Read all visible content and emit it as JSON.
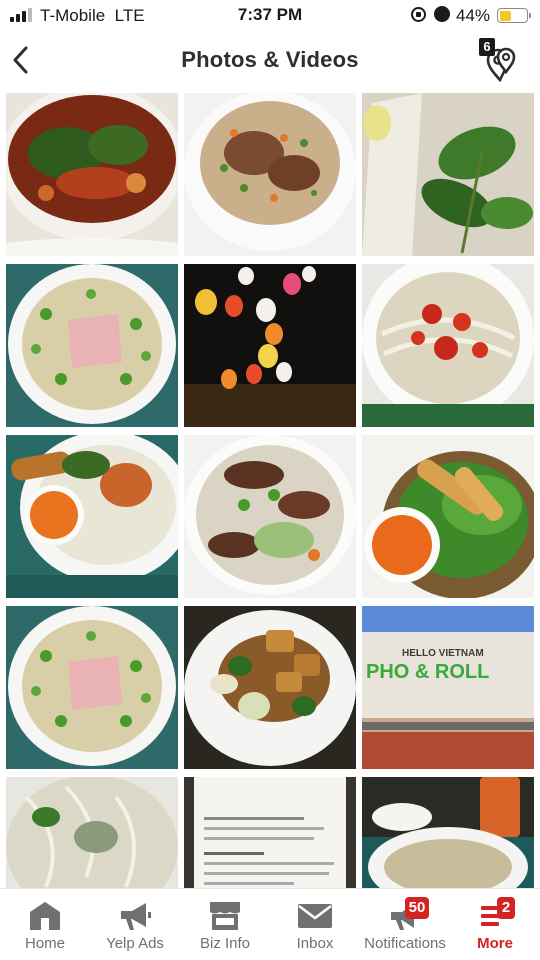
{
  "status_bar": {
    "carrier": "T-Mobile",
    "network": "LTE",
    "time": "7:37 PM",
    "battery_percent": "44%",
    "battery_level": 0.44
  },
  "header": {
    "title": "Photos & Videos",
    "map_count": "6"
  },
  "photos": [
    {
      "subject": "soup-with-herbs"
    },
    {
      "subject": "fried-rice-with-beef"
    },
    {
      "subject": "fresh-herbs-basil"
    },
    {
      "subject": "pho-bowl"
    },
    {
      "subject": "restaurant-lanterns"
    },
    {
      "subject": "noodle-soup-chili"
    },
    {
      "subject": "vermicelli-shrimp-egg-roll"
    },
    {
      "subject": "grilled-beef-noodle-salad"
    },
    {
      "subject": "egg-rolls-lettuce"
    },
    {
      "subject": "pho-bowl"
    },
    {
      "subject": "tofu-stir-fry"
    },
    {
      "subject": "storefront-sign",
      "sign_line1": "HELLO VIETNAM",
      "sign_line2": "PHO & ROLL"
    },
    {
      "subject": "pho-with-bean-sprouts"
    },
    {
      "subject": "menu-page"
    },
    {
      "subject": "table-with-drink"
    }
  ],
  "tabbar": {
    "items": [
      {
        "label": "Home",
        "icon": "store-icon"
      },
      {
        "label": "Yelp Ads",
        "icon": "megaphone-icon"
      },
      {
        "label": "Biz Info",
        "icon": "storefront-icon"
      },
      {
        "label": "Inbox",
        "icon": "envelope-icon"
      },
      {
        "label": "Notifications",
        "icon": "megaphone-bell-icon",
        "badge": "50"
      },
      {
        "label": "More",
        "icon": "menu-list-icon",
        "badge": "2",
        "active": true
      }
    ]
  },
  "colors": {
    "accent_red": "#d32323",
    "tab_gray": "#6e7072",
    "battery_yellow": "#f6c522"
  }
}
